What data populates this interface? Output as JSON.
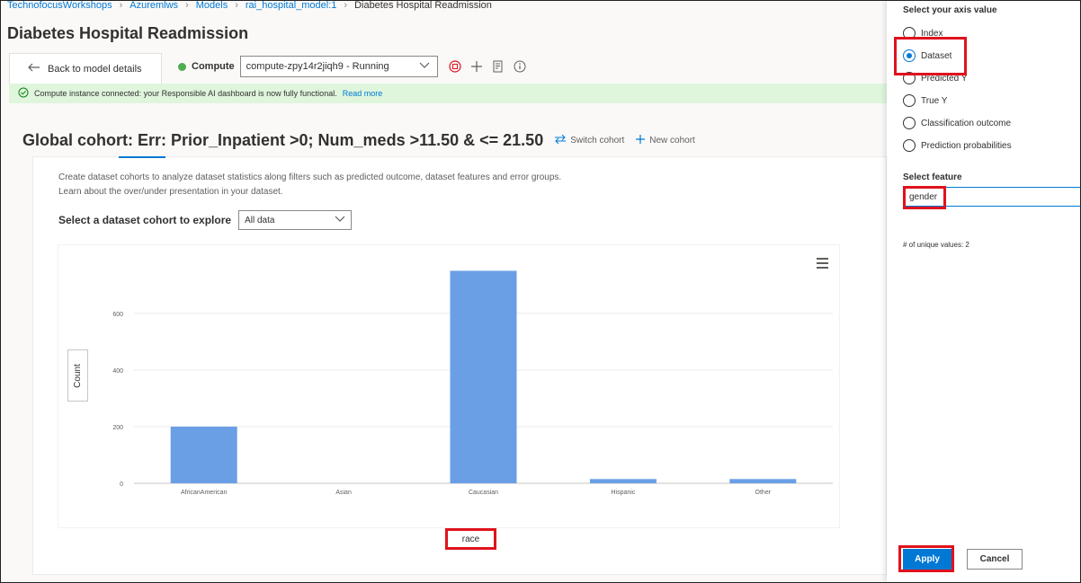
{
  "breadcrumb": [
    "TechnofocusWorkshops",
    "Azuremlws",
    "Models",
    "rai_hospital_model:1",
    "Diabetes Hospital Readmission"
  ],
  "page_title": "Diabetes Hospital Readmission",
  "toolbar": {
    "back_label": "Back to model details",
    "compute_label": "Compute",
    "compute_value": "compute-zpy14r2jiqh9 - Running",
    "icons": [
      "stop-icon",
      "add-icon",
      "report-icon",
      "info-icon"
    ]
  },
  "banner": {
    "text": "Compute instance connected: your Responsible AI dashboard is now fully functional.",
    "link": "Read more"
  },
  "cohort": {
    "title": "Global cohort: Err: Prior_Inpatient >0; Num_meds >11.50 & <= 21.50",
    "switch_label": "Switch cohort",
    "new_label": "New cohort"
  },
  "description": "Create dataset cohorts to analyze dataset statistics along filters such as predicted outcome, dataset features and error groups. Learn about the over/under presentation in your dataset.",
  "explore": {
    "label": "Select a dataset cohort to explore",
    "value": "All data"
  },
  "chart_data": {
    "type": "bar",
    "categories": [
      "AfricanAmerican",
      "Asian",
      "Caucasian",
      "Hispanic",
      "Other"
    ],
    "values": [
      200,
      0,
      750,
      15,
      15
    ],
    "xlabel": "race",
    "ylabel": "Count",
    "yticks": [
      0,
      200,
      400,
      600
    ],
    "ylim": [
      0,
      780
    ],
    "grid": true,
    "bar_color": "#6a9fe6"
  },
  "panel": {
    "axis_heading": "Select your axis value",
    "axis_options": [
      {
        "label": "Index",
        "checked": false
      },
      {
        "label": "Dataset",
        "checked": true
      },
      {
        "label": "Predicted Y",
        "checked": false
      },
      {
        "label": "True Y",
        "checked": false
      },
      {
        "label": "Classification outcome",
        "checked": false
      },
      {
        "label": "Prediction probabilities",
        "checked": false
      }
    ],
    "feature_label": "Select feature",
    "feature_value": "gender",
    "unique_values": "# of unique values: 2",
    "apply_label": "Apply",
    "cancel_label": "Cancel"
  },
  "colors": {
    "accent": "#0078d4",
    "highlight": "#e0121c",
    "banner_bg": "#dff6dd",
    "status_running": "#4caf50"
  }
}
